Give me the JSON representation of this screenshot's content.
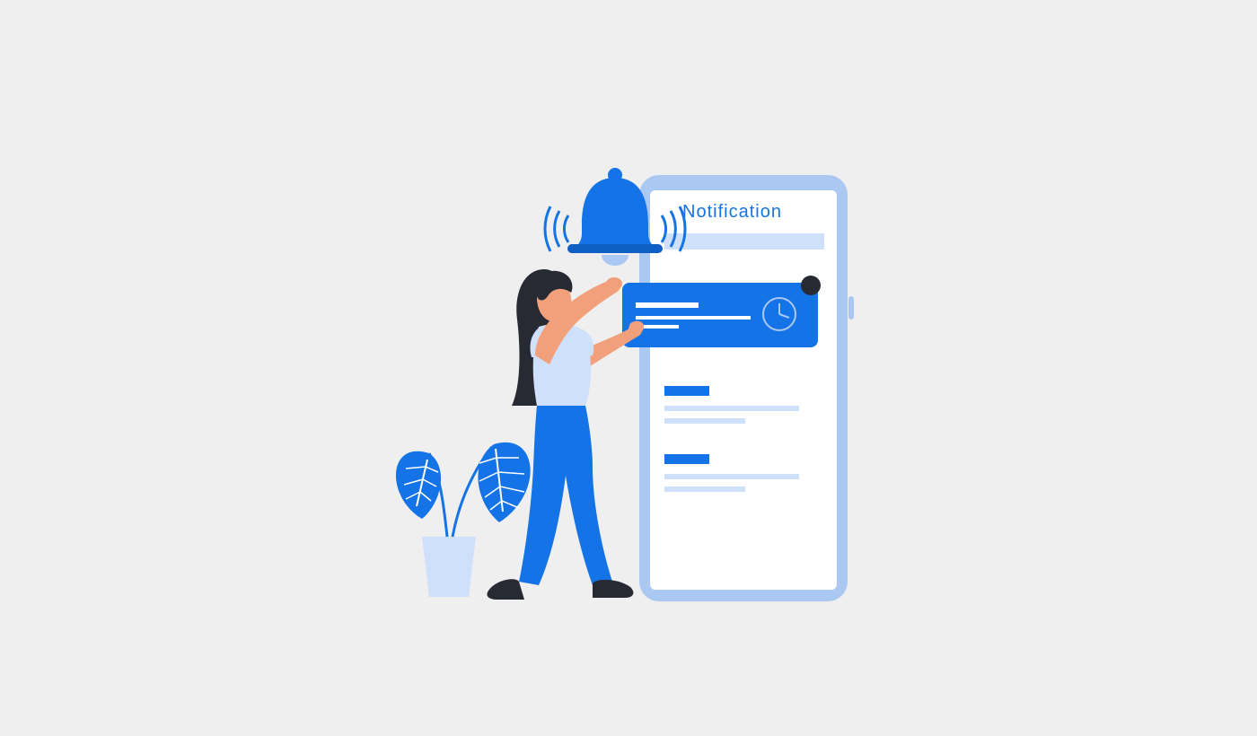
{
  "header": {
    "title": "Notification"
  },
  "colors": {
    "bg": "#efefef",
    "phone_body": "#aac8f2",
    "phone_screen": "#ffffff",
    "primary": "#1473e6",
    "primary_dark": "#0f5fc4",
    "soft_blue": "#cfe0fa",
    "skin": "#f2a07b",
    "hair": "#272a33",
    "dark": "#272a33"
  },
  "icons": {
    "bell": "bell-icon",
    "clock": "clock-icon",
    "plant_left": "plant-icon",
    "plant_right": "plant-icon"
  }
}
